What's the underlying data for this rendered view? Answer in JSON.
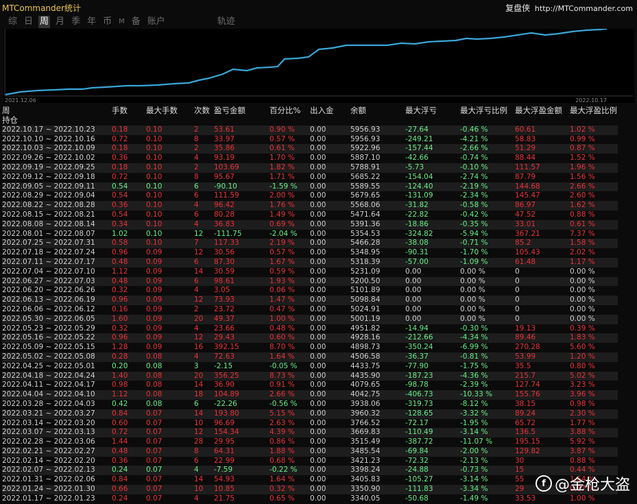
{
  "app_title": "MTCommander统计",
  "brand": {
    "name": "复盘侠",
    "url": "http://MTCommander.com"
  },
  "tabs": [
    "综",
    "日",
    "周",
    "月",
    "季",
    "年",
    "币",
    "M",
    "备",
    "账户",
    "轨迹"
  ],
  "active_tab": "周",
  "equity_chart": {
    "start_date": "2021.12.06",
    "end_date": "2022.10.17"
  },
  "headers": [
    "周",
    "手数",
    "最大手数",
    "次数",
    "盈亏金额",
    "百分比%",
    "出入金",
    "余额",
    "最大浮亏",
    "最大浮亏比例",
    "最大浮盈金额",
    "最大浮盈比例"
  ],
  "holding_label": "持仓",
  "rows": [
    [
      "2022.10.17 ~ 2022.10.23",
      "0.18",
      "0.10",
      "2",
      "53.61",
      "0.90 %",
      "0.00",
      "5956.93",
      "-27.64",
      "-0.46 %",
      "60.61",
      "1.02 %"
    ],
    [
      "2022.10.10 ~ 2022.10.16",
      "0.72",
      "0.10",
      "8",
      "33.97",
      "0.57 %",
      "0.00",
      "5956.93",
      "-249.21",
      "-4.21 %",
      "58.83",
      "0.99 %"
    ],
    [
      "2022.10.03 ~ 2022.10.09",
      "0.18",
      "0.10",
      "2",
      "35.86",
      "0.61 %",
      "0.00",
      "5922.96",
      "-157.44",
      "-2.66 %",
      "51.29",
      "0.87 %"
    ],
    [
      "2022.09.26 ~ 2022.10.02",
      "0.36",
      "0.10",
      "4",
      "93.19",
      "1.70 %",
      "0.00",
      "5887.10",
      "-42.66",
      "-0.74 %",
      "88.44",
      "1.52 %"
    ],
    [
      "2022.09.19 ~ 2022.09.25",
      "0.18",
      "0.10",
      "2",
      "103.69",
      "1.82 %",
      "0.00",
      "5788.91",
      "-5.73",
      "-0.10 %",
      "111.57",
      "1.96 %"
    ],
    [
      "2022.09.12 ~ 2022.09.18",
      "0.72",
      "0.10",
      "8",
      "95.67",
      "1.71 %",
      "0.00",
      "5685.22",
      "-154.04",
      "-2.74 %",
      "87.79",
      "1.56 %"
    ],
    [
      "2022.09.05 ~ 2022.09.11",
      "0.54",
      "0.10",
      "6",
      "-90.10",
      "-1.59 %",
      "0.00",
      "5589.55",
      "-124.40",
      "-2.19 %",
      "144.68",
      "2.66 %"
    ],
    [
      "2022.08.29 ~ 2022.09.04",
      "0.54",
      "0.10",
      "6",
      "111.59",
      "2.00 %",
      "0.00",
      "5679.65",
      "-131.09",
      "-2.34 %",
      "145.47",
      "2.60 %"
    ],
    [
      "2022.08.22 ~ 2022.08.28",
      "0.36",
      "0.10",
      "4",
      "96.42",
      "1.76 %",
      "0.00",
      "5568.06",
      "-31.82",
      "-0.58 %",
      "86.97",
      "1.62 %"
    ],
    [
      "2022.08.15 ~ 2022.08.21",
      "0.54",
      "0.10",
      "6",
      "80.28",
      "1.49 %",
      "0.00",
      "5471.64",
      "-22.82",
      "-0.42 %",
      "47.52",
      "0.88 %"
    ],
    [
      "2022.08.08 ~ 2022.08.14",
      "0.34",
      "0.10",
      "4",
      "36.83",
      "0.69 %",
      "0.00",
      "5391.36",
      "-18.86",
      "-0.35 %",
      "33.01",
      "0.61 %"
    ],
    [
      "2022.08.01 ~ 2022.08.07",
      "1.02",
      "0.10",
      "12",
      "-111.75",
      "-2.04 %",
      "0.00",
      "5354.53",
      "-324.82",
      "-5.94 %",
      "367.21",
      "7.37 %"
    ],
    [
      "2022.07.25 ~ 2022.07.31",
      "0.58",
      "0.10",
      "7",
      "117.33",
      "2.19 %",
      "0.00",
      "5466.28",
      "-38.08",
      "-0.71 %",
      "85.2",
      "1.58 %"
    ],
    [
      "2022.07.18 ~ 2022.07.24",
      "0.96",
      "0.09",
      "12",
      "30.56",
      "0.57 %",
      "0.00",
      "5348.95",
      "-90.31",
      "-1.70 %",
      "105.43",
      "2.02 %"
    ],
    [
      "2022.07.11 ~ 2022.07.17",
      "0.48",
      "0.09",
      "6",
      "87.30",
      "1.67 %",
      "0.00",
      "5318.39",
      "-57.00",
      "-1.09 %",
      "61.48",
      "1.17 %"
    ],
    [
      "2022.07.04 ~ 2022.07.10",
      "1.12",
      "0.09",
      "14",
      "30.59",
      "0.59 %",
      "0.00",
      "5231.09",
      "0.00",
      "0.00 %",
      "0",
      "0.00 %"
    ],
    [
      "2022.06.27 ~ 2022.07.03",
      "0.48",
      "0.09",
      "6",
      "98.61",
      "1.93 %",
      "0.00",
      "5200.50",
      "0.00",
      "0.00 %",
      "0",
      "0.00 %"
    ],
    [
      "2022.06.20 ~ 2022.06.26",
      "0.32",
      "0.09",
      "4",
      "3.05",
      "0.06 %",
      "0.00",
      "5101.89",
      "0.00",
      "0.00 %",
      "0",
      "0.00 %"
    ],
    [
      "2022.06.13 ~ 2022.06.19",
      "0.96",
      "0.09",
      "12",
      "73.93",
      "1.47 %",
      "0.00",
      "5098.84",
      "0.00",
      "0.00 %",
      "0",
      "0.00 %"
    ],
    [
      "2022.06.06 ~ 2022.06.12",
      "0.16",
      "0.09",
      "2",
      "23.72",
      "0.47 %",
      "0.00",
      "5024.91",
      "0.00",
      "0.00 %",
      "0",
      "0.00 %"
    ],
    [
      "2022.05.30 ~ 2022.06.05",
      "1.60",
      "0.09",
      "20",
      "49.37",
      "1.00 %",
      "0.00",
      "5001.19",
      "0.00",
      "0.00 %",
      "0",
      "0.00 %"
    ],
    [
      "2022.05.23 ~ 2022.05.29",
      "0.32",
      "0.09",
      "4",
      "23.66",
      "0.48 %",
      "0.00",
      "4951.82",
      "-14.94",
      "-0.30 %",
      "19.13",
      "0.39 %"
    ],
    [
      "2022.05.16 ~ 2022.05.22",
      "0.96",
      "0.09",
      "12",
      "29.43",
      "0.60 %",
      "0.00",
      "4928.16",
      "-212.66",
      "-4.34 %",
      "89.46",
      "1.83 %"
    ],
    [
      "2022.05.09 ~ 2022.05.15",
      "1.28",
      "0.09",
      "16",
      "392.15",
      "8.70 %",
      "0.00",
      "4898.73",
      "-350.24",
      "-6.99 %",
      "270.28",
      "5.60 %"
    ],
    [
      "2022.05.02 ~ 2022.05.08",
      "0.28",
      "0.08",
      "4",
      "72.63",
      "1.64 %",
      "0.00",
      "4506.58",
      "-36.37",
      "-0.81 %",
      "53.99",
      "1.20 %"
    ],
    [
      "2022.04.25 ~ 2022.05.01",
      "0.20",
      "0.08",
      "3",
      "-2.15",
      "-0.05 %",
      "0.00",
      "4433.75",
      "-77.90",
      "-1.75 %",
      "35.5",
      "0.80 %"
    ],
    [
      "2022.04.18 ~ 2022.04.24",
      "1.40",
      "0.08",
      "20",
      "356.25",
      "8.73 %",
      "0.00",
      "4435.90",
      "-187.23",
      "-4.36 %",
      "215.7",
      "5.02 %"
    ],
    [
      "2022.04.11 ~ 2022.04.17",
      "0.98",
      "0.08",
      "14",
      "36.90",
      "0.91 %",
      "0.00",
      "4079.65",
      "-98.78",
      "-2.39 %",
      "127.74",
      "3.23 %"
    ],
    [
      "2022.04.04 ~ 2022.04.10",
      "1.12",
      "0.08",
      "18",
      "104.89",
      "2.66 %",
      "0.00",
      "4042.75",
      "-406.73",
      "-10.33 %",
      "155.76",
      "3.96 %"
    ],
    [
      "2022.03.28 ~ 2022.04.03",
      "0.42",
      "0.08",
      "6",
      "-22.26",
      "-0.56 %",
      "0.00",
      "3938.06",
      "-319.73",
      "-8.12 %",
      "38.15",
      "0.98 %"
    ],
    [
      "2022.03.21 ~ 2022.03.27",
      "0.84",
      "0.07",
      "14",
      "193.80",
      "5.15 %",
      "0.00",
      "3960.32",
      "-128.65",
      "-3.32 %",
      "89.24",
      "2.30 %"
    ],
    [
      "2022.03.14 ~ 2022.03.20",
      "0.60",
      "0.07",
      "10",
      "96.69",
      "2.63 %",
      "0.00",
      "3766.52",
      "-72.17",
      "-1.95 %",
      "65.72",
      "1.77 %"
    ],
    [
      "2022.03.07 ~ 2022.03.13",
      "0.72",
      "0.07",
      "12",
      "154.34",
      "4.39 %",
      "0.00",
      "3669.83",
      "-110.49",
      "-3.14 %",
      "136.5",
      "3.88 %"
    ],
    [
      "2022.02.28 ~ 2022.03.06",
      "1.44",
      "0.07",
      "28",
      "29.95",
      "0.86 %",
      "0.00",
      "3515.49",
      "-387.72",
      "-11.07 %",
      "195.15",
      "5.92 %"
    ],
    [
      "2022.02.21 ~ 2022.02.27",
      "0.48",
      "0.07",
      "8",
      "64.31",
      "1.88 %",
      "0.00",
      "3485.54",
      "-69.84",
      "-2.00 %",
      "129.82",
      "3.87 %"
    ],
    [
      "2022.02.14 ~ 2022.02.20",
      "0.36",
      "0.07",
      "6",
      "22.99",
      "0.68 %",
      "0.00",
      "3421.23",
      "-72.32",
      "-2.13 %",
      "30",
      "0.88 %"
    ],
    [
      "2022.02.07 ~ 2022.02.13",
      "0.24",
      "0.07",
      "4",
      "-7.59",
      "-0.22 %",
      "0.00",
      "3398.24",
      "-24.88",
      "-0.73 %",
      "15",
      "0.44 %"
    ],
    [
      "2022.01.31 ~ 2022.02.06",
      "0.84",
      "0.07",
      "14",
      "54.93",
      "1.64 %",
      "0.00",
      "3405.83",
      "-105.27",
      "-3.14 %",
      "55",
      "1.64 %"
    ],
    [
      "2022.01.24 ~ 2022.01.30",
      "0.66",
      "0.07",
      "10",
      "10.85",
      "0.32 %",
      "0.00",
      "3350.90",
      "-111.83",
      "-3.34 %",
      "29",
      "0.87 %"
    ],
    [
      "2022.01.17 ~ 2022.01.23",
      "0.24",
      "0.07",
      "4",
      "21.75",
      "0.65 %",
      "0.00",
      "3340.05",
      "-50.68",
      "-1.49 %",
      "33.53",
      "1.00 %"
    ]
  ],
  "watermark": "@金枪大盗"
}
